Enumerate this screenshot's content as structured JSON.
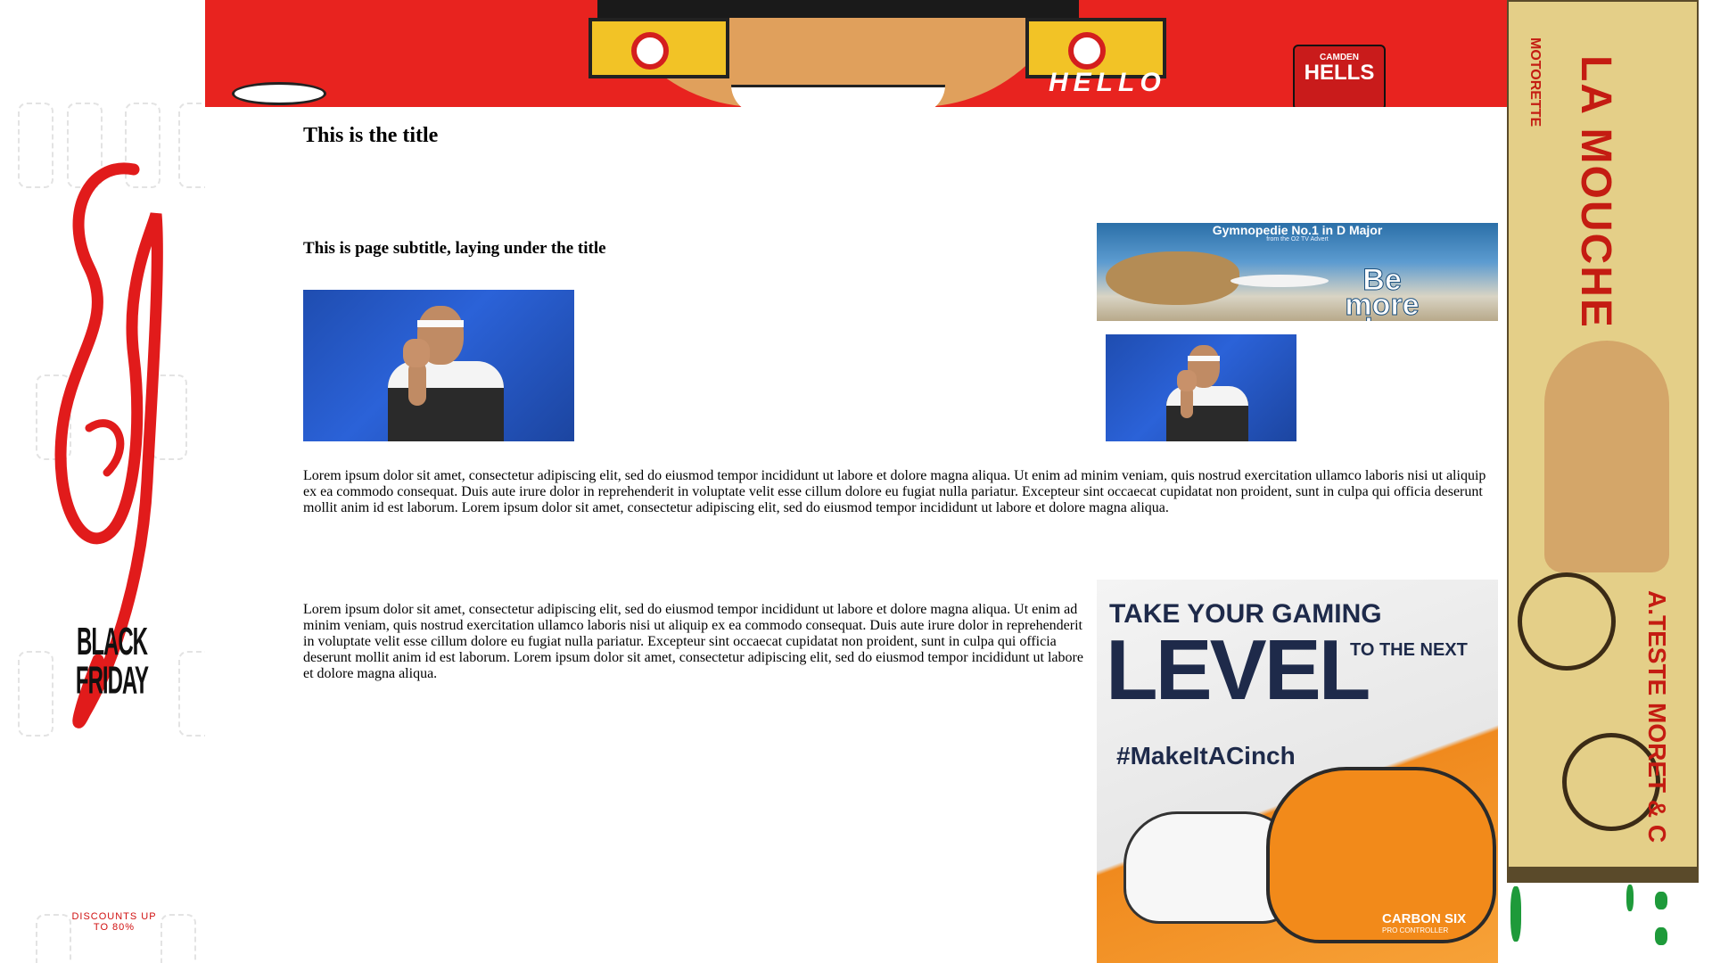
{
  "main": {
    "title": "This is the title",
    "subtitle": "This is page subtitle, laying under the title",
    "paragraph_1": "Lorem ipsum dolor sit amet, consectetur adipiscing elit, sed do eiusmod tempor incididunt ut labore et dolore magna aliqua. Ut enim ad minim veniam, quis nostrud exercitation ullamco laboris nisi ut aliquip ex ea commodo consequat. Duis aute irure dolor in reprehenderit in voluptate velit esse cillum dolore eu fugiat nulla pariatur. Excepteur sint occaecat cupidatat non proident, sunt in culpa qui officia deserunt mollit anim id est laborum. Lorem ipsum dolor sit amet, consectetur adipiscing elit, sed do eiusmod tempor incididunt ut labore et dolore magna aliqua.",
    "paragraph_2": "Lorem ipsum dolor sit amet, consectetur adipiscing elit, sed do eiusmod tempor incididunt ut labore et dolore magna aliqua. Ut enim ad minim veniam, quis nostrud exercitation ullamco laboris nisi ut aliquip ex ea commodo consequat. Duis aute irure dolor in reprehenderit in voluptate velit esse cillum dolore eu fugiat nulla pariatur. Excepteur sint occaecat cupidatat non proident, sunt in culpa qui officia deserunt mollit anim id est laborum. Lorem ipsum dolor sit amet, consectetur adipiscing elit, sed do eiusmod tempor incididunt ut labore et dolore magna aliqua."
  },
  "ads": {
    "top_banner": {
      "headline": "HELLO",
      "can_brand": "CAMDEN",
      "can_name": "HELLS",
      "colors": {
        "background": "#e8231f",
        "glasses": "#f2c326"
      }
    },
    "left_skyscraper": {
      "script_word": "Sale",
      "label": "BLACK FRIDAY",
      "footer": "DISCOUNTS UP TO 80%",
      "colors": {
        "script": "#e11b1b"
      }
    },
    "right_skyscraper": {
      "brand": "LA MOUCHE",
      "sub": "MOTORETTE",
      "bottom": "A.TESTE MORET & C",
      "colors": {
        "background": "#e4cf88",
        "text": "#c41c12"
      }
    },
    "cat_ad": {
      "headline": "Gymnopedie No.1 in D Major",
      "small_print": "from the O2 TV Advert",
      "slogan_line1": "Be",
      "slogan_line2": "more",
      "slogan_line3": "dog"
    },
    "gaming_ad": {
      "line1": "TAKE YOUR GAMING",
      "big": "LEVEL",
      "line2": "TO THE NEXT",
      "hashtag": "#MakeItACinch",
      "product": "CARBON SIX",
      "product_sub": "PRO CONTROLLER",
      "colors": {
        "accent": "#f28a1a",
        "text": "#1e2a4a"
      }
    }
  },
  "images": {
    "tennis_photo_large": "tennis-player-fist-photo",
    "tennis_photo_small": "tennis-player-fist-photo"
  }
}
